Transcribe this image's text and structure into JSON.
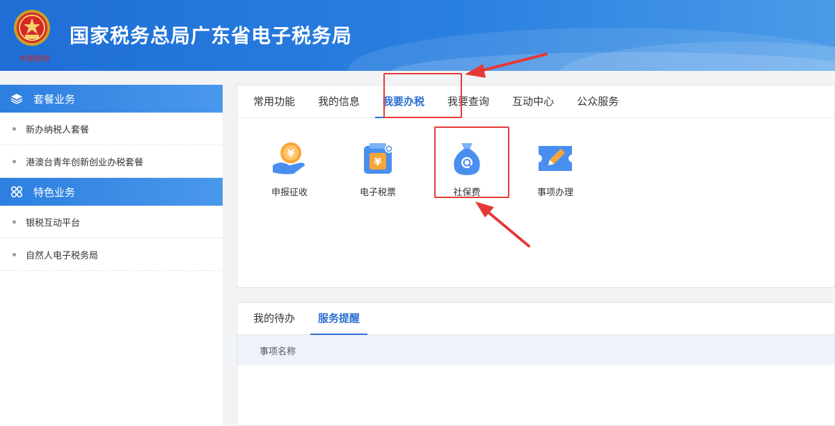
{
  "header": {
    "logo_caption": "中国税务",
    "title": "国家税务总局广东省电子税务局"
  },
  "sidebar": {
    "groups": [
      {
        "label": "套餐业务",
        "icon": "layers-icon",
        "items": [
          {
            "label": "新办纳税人套餐"
          },
          {
            "label": "港澳台青年创新创业办税套餐"
          }
        ]
      },
      {
        "label": "特色业务",
        "icon": "grid-icon",
        "items": [
          {
            "label": "银税互动平台"
          },
          {
            "label": "自然人电子税务局"
          }
        ]
      }
    ]
  },
  "main": {
    "tabs": [
      {
        "label": "常用功能"
      },
      {
        "label": "我的信息"
      },
      {
        "label": "我要办税",
        "active": true
      },
      {
        "label": "我要查询"
      },
      {
        "label": "互动中心"
      },
      {
        "label": "公众服务"
      }
    ],
    "tiles": [
      {
        "label": "申报征收",
        "icon": "hand-coin-icon"
      },
      {
        "label": "电子税票",
        "icon": "tax-ticket-icon"
      },
      {
        "label": "社保费",
        "icon": "money-bag-search-icon"
      },
      {
        "label": "事项办理",
        "icon": "ticket-edit-icon"
      }
    ]
  },
  "service": {
    "tabs": [
      {
        "label": "我的待办"
      },
      {
        "label": "服务提醒",
        "active": true
      }
    ],
    "table": {
      "columns": [
        "事项名称"
      ]
    }
  },
  "colors": {
    "accent": "#2b6fcf",
    "header_start": "#1f6ed6",
    "annotation": "#e53935"
  }
}
